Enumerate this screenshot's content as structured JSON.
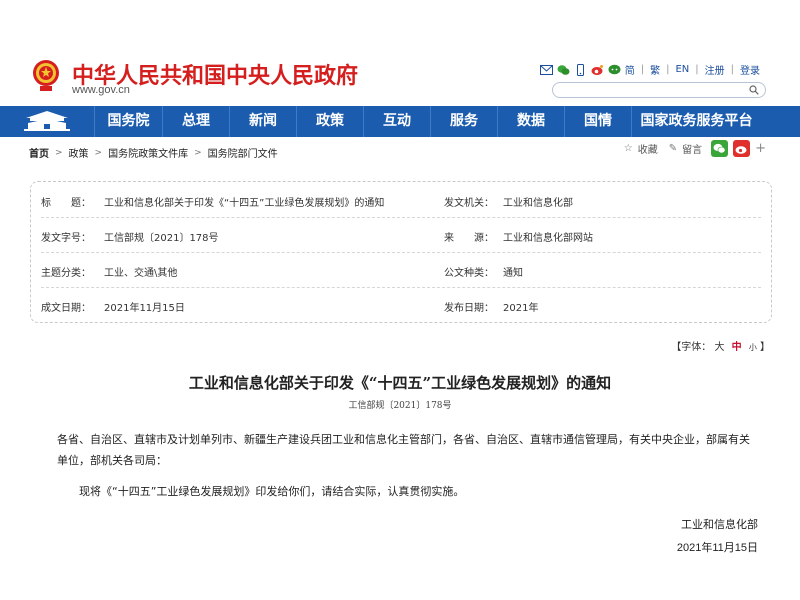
{
  "header": {
    "site_title": "中华人民共和国中央人民政府",
    "site_domain": "www.gov.cn",
    "toplinks": [
      "简",
      "繁",
      "EN",
      "注册",
      "登录"
    ],
    "icons": [
      "mail-icon",
      "wechat-icon",
      "mobile-icon",
      "weibo-icon",
      "chat-icon"
    ]
  },
  "nav": {
    "items": [
      "国务院",
      "总理",
      "新闻",
      "政策",
      "互动",
      "服务",
      "数据",
      "国情",
      "国家政务服务平台"
    ]
  },
  "breadcrumb": [
    "首页",
    "政策",
    "国务院政策文件库",
    "国务院部门文件"
  ],
  "tools": {
    "favorite": "收藏",
    "comment": "留言"
  },
  "info": {
    "title_label": "标　　题：",
    "title_value": "工业和信息化部关于印发《“十四五”工业绿色发展规划》的通知",
    "issuer_label": "发文机关：",
    "issuer_value": "工业和信息化部",
    "docno_label": "发文字号：",
    "docno_value": "工信部规〔2021〕178号",
    "source_label": "来　　源：",
    "source_value": "工业和信息化部网站",
    "topic_label": "主题分类：",
    "topic_value": "工业、交通\\其他",
    "type_label": "公文种类：",
    "type_value": "通知",
    "written_label": "成文日期：",
    "written_value": "2021年11月15日",
    "published_label": "发布日期：",
    "published_value": "2021年"
  },
  "fontsize": {
    "label": "【字体：",
    "big": "大",
    "mid": "中",
    "small": "小",
    "end": "】"
  },
  "doc": {
    "title": "工业和信息化部关于印发《“十四五”工业绿色发展规划》的通知",
    "number": "工信部规〔2021〕178号",
    "recipients": "各省、自治区、直辖市及计划单列市、新疆生产建设兵团工业和信息化主管部门，各省、自治区、直辖市通信管理局，有关中央企业，部属有关单位，部机关各司局：",
    "body": "现将《“十四五”工业绿色发展规划》印发给你们，请结合实际，认真贯彻实施。",
    "signer": "工业和信息化部",
    "date": "2021年11月15日"
  }
}
